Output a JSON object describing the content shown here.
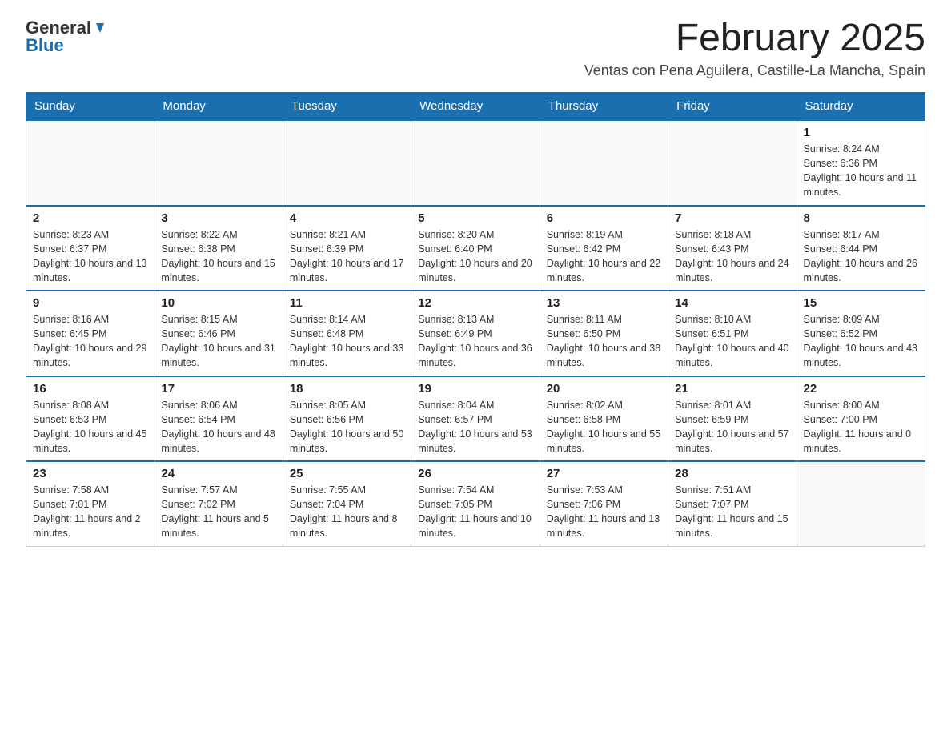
{
  "logo": {
    "general": "General",
    "blue": "Blue",
    "tagline": ""
  },
  "title": {
    "month_year": "February 2025",
    "location": "Ventas con Pena Aguilera, Castille-La Mancha, Spain"
  },
  "weekdays": [
    "Sunday",
    "Monday",
    "Tuesday",
    "Wednesday",
    "Thursday",
    "Friday",
    "Saturday"
  ],
  "weeks": [
    [
      {
        "day": "",
        "info": ""
      },
      {
        "day": "",
        "info": ""
      },
      {
        "day": "",
        "info": ""
      },
      {
        "day": "",
        "info": ""
      },
      {
        "day": "",
        "info": ""
      },
      {
        "day": "",
        "info": ""
      },
      {
        "day": "1",
        "info": "Sunrise: 8:24 AM\nSunset: 6:36 PM\nDaylight: 10 hours and 11 minutes."
      }
    ],
    [
      {
        "day": "2",
        "info": "Sunrise: 8:23 AM\nSunset: 6:37 PM\nDaylight: 10 hours and 13 minutes."
      },
      {
        "day": "3",
        "info": "Sunrise: 8:22 AM\nSunset: 6:38 PM\nDaylight: 10 hours and 15 minutes."
      },
      {
        "day": "4",
        "info": "Sunrise: 8:21 AM\nSunset: 6:39 PM\nDaylight: 10 hours and 17 minutes."
      },
      {
        "day": "5",
        "info": "Sunrise: 8:20 AM\nSunset: 6:40 PM\nDaylight: 10 hours and 20 minutes."
      },
      {
        "day": "6",
        "info": "Sunrise: 8:19 AM\nSunset: 6:42 PM\nDaylight: 10 hours and 22 minutes."
      },
      {
        "day": "7",
        "info": "Sunrise: 8:18 AM\nSunset: 6:43 PM\nDaylight: 10 hours and 24 minutes."
      },
      {
        "day": "8",
        "info": "Sunrise: 8:17 AM\nSunset: 6:44 PM\nDaylight: 10 hours and 26 minutes."
      }
    ],
    [
      {
        "day": "9",
        "info": "Sunrise: 8:16 AM\nSunset: 6:45 PM\nDaylight: 10 hours and 29 minutes."
      },
      {
        "day": "10",
        "info": "Sunrise: 8:15 AM\nSunset: 6:46 PM\nDaylight: 10 hours and 31 minutes."
      },
      {
        "day": "11",
        "info": "Sunrise: 8:14 AM\nSunset: 6:48 PM\nDaylight: 10 hours and 33 minutes."
      },
      {
        "day": "12",
        "info": "Sunrise: 8:13 AM\nSunset: 6:49 PM\nDaylight: 10 hours and 36 minutes."
      },
      {
        "day": "13",
        "info": "Sunrise: 8:11 AM\nSunset: 6:50 PM\nDaylight: 10 hours and 38 minutes."
      },
      {
        "day": "14",
        "info": "Sunrise: 8:10 AM\nSunset: 6:51 PM\nDaylight: 10 hours and 40 minutes."
      },
      {
        "day": "15",
        "info": "Sunrise: 8:09 AM\nSunset: 6:52 PM\nDaylight: 10 hours and 43 minutes."
      }
    ],
    [
      {
        "day": "16",
        "info": "Sunrise: 8:08 AM\nSunset: 6:53 PM\nDaylight: 10 hours and 45 minutes."
      },
      {
        "day": "17",
        "info": "Sunrise: 8:06 AM\nSunset: 6:54 PM\nDaylight: 10 hours and 48 minutes."
      },
      {
        "day": "18",
        "info": "Sunrise: 8:05 AM\nSunset: 6:56 PM\nDaylight: 10 hours and 50 minutes."
      },
      {
        "day": "19",
        "info": "Sunrise: 8:04 AM\nSunset: 6:57 PM\nDaylight: 10 hours and 53 minutes."
      },
      {
        "day": "20",
        "info": "Sunrise: 8:02 AM\nSunset: 6:58 PM\nDaylight: 10 hours and 55 minutes."
      },
      {
        "day": "21",
        "info": "Sunrise: 8:01 AM\nSunset: 6:59 PM\nDaylight: 10 hours and 57 minutes."
      },
      {
        "day": "22",
        "info": "Sunrise: 8:00 AM\nSunset: 7:00 PM\nDaylight: 11 hours and 0 minutes."
      }
    ],
    [
      {
        "day": "23",
        "info": "Sunrise: 7:58 AM\nSunset: 7:01 PM\nDaylight: 11 hours and 2 minutes."
      },
      {
        "day": "24",
        "info": "Sunrise: 7:57 AM\nSunset: 7:02 PM\nDaylight: 11 hours and 5 minutes."
      },
      {
        "day": "25",
        "info": "Sunrise: 7:55 AM\nSunset: 7:04 PM\nDaylight: 11 hours and 8 minutes."
      },
      {
        "day": "26",
        "info": "Sunrise: 7:54 AM\nSunset: 7:05 PM\nDaylight: 11 hours and 10 minutes."
      },
      {
        "day": "27",
        "info": "Sunrise: 7:53 AM\nSunset: 7:06 PM\nDaylight: 11 hours and 13 minutes."
      },
      {
        "day": "28",
        "info": "Sunrise: 7:51 AM\nSunset: 7:07 PM\nDaylight: 11 hours and 15 minutes."
      },
      {
        "day": "",
        "info": ""
      }
    ]
  ]
}
